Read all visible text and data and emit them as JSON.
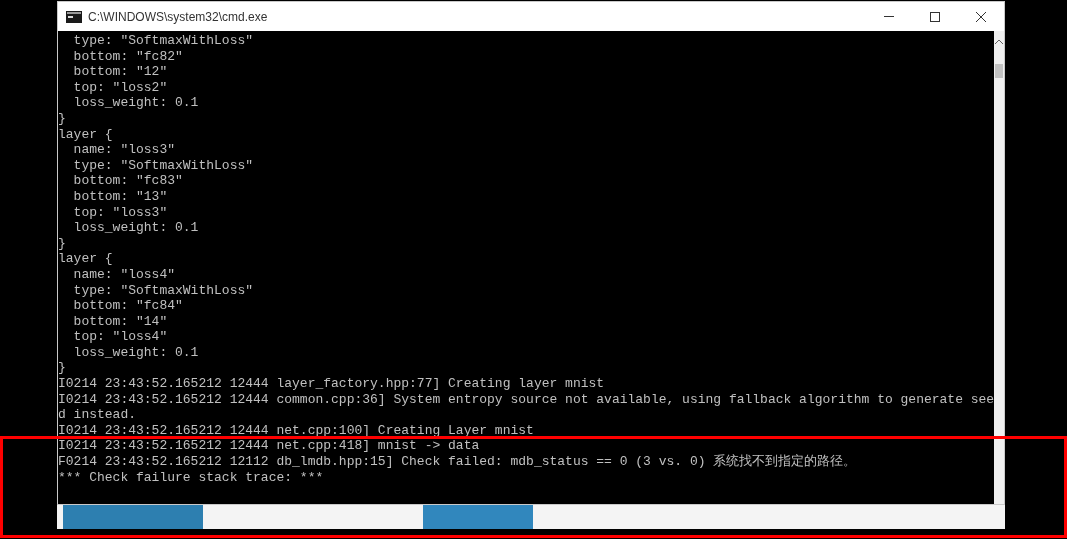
{
  "window": {
    "title": "C:\\WINDOWS\\system32\\cmd.exe"
  },
  "console": {
    "lines": [
      "  type: \"SoftmaxWithLoss\"",
      "  bottom: \"fc82\"",
      "  bottom: \"12\"",
      "  top: \"loss2\"",
      "  loss_weight: 0.1",
      "}",
      "layer {",
      "  name: \"loss3\"",
      "  type: \"SoftmaxWithLoss\"",
      "  bottom: \"fc83\"",
      "  bottom: \"13\"",
      "  top: \"loss3\"",
      "  loss_weight: 0.1",
      "}",
      "layer {",
      "  name: \"loss4\"",
      "  type: \"SoftmaxWithLoss\"",
      "  bottom: \"fc84\"",
      "  bottom: \"14\"",
      "  top: \"loss4\"",
      "  loss_weight: 0.1",
      "}",
      "I0214 23:43:52.165212 12444 layer_factory.hpp:77] Creating layer mnist",
      "I0214 23:43:52.165212 12444 common.cpp:36] System entropy source not available, using fallback algorithm to generate see",
      "d instead.",
      "I0214 23:43:52.165212 12444 net.cpp:100] Creating Layer mnist",
      "I0214 23:43:52.165212 12444 net.cpp:418] mnist -> data",
      "F0214 23:43:52.165212 12112 db_lmdb.hpp:15] Check failed: mdb_status == 0 (3 vs. 0) 系统找不到指定的路径。",
      "*** Check failure stack trace: ***"
    ]
  }
}
